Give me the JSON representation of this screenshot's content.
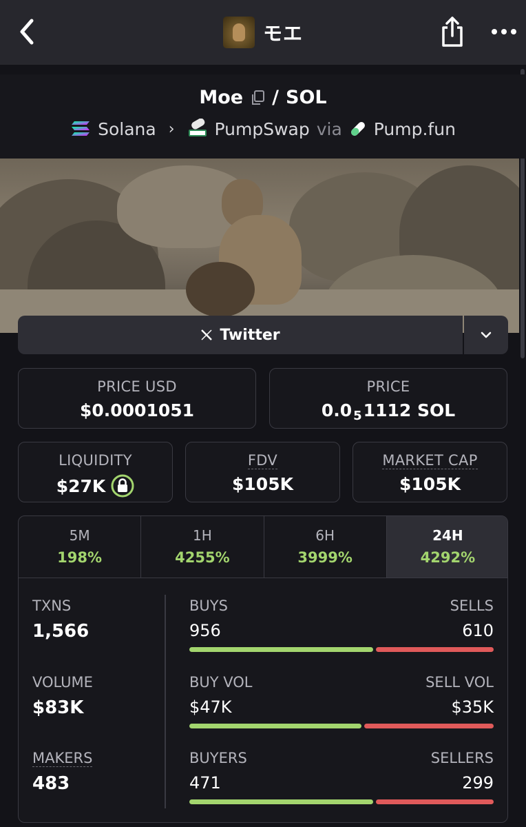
{
  "nav": {
    "title": "モエ",
    "icons": {
      "back": "chevron-left-icon",
      "share": "share-icon",
      "more": "more-dots-icon"
    }
  },
  "header": {
    "pair_base": "Moe",
    "pair_sep": "/",
    "pair_quote": "SOL",
    "chain": "Solana",
    "dex": "PumpSwap",
    "via_label": "via",
    "launchpad": "Pump.fun"
  },
  "social": {
    "twitter_label": "Twitter"
  },
  "stats": {
    "price_usd": {
      "label": "PRICE USD",
      "value": "$0.0001051"
    },
    "price": {
      "label": "PRICE",
      "prefix": "0.0",
      "sub": "5",
      "suffix": "1112 SOL"
    },
    "liquidity": {
      "label": "LIQUIDITY",
      "value": "$27K"
    },
    "fdv": {
      "label": "FDV",
      "value": "$105K"
    },
    "market_cap": {
      "label": "MARKET CAP",
      "value": "$105K"
    }
  },
  "timeframes": [
    {
      "label": "5M",
      "change": "198%"
    },
    {
      "label": "1H",
      "change": "4255%"
    },
    {
      "label": "6H",
      "change": "3999%"
    },
    {
      "label": "24H",
      "change": "4292%"
    }
  ],
  "active_timeframe": "24H",
  "metrics": {
    "txns": {
      "label": "TXNS",
      "value": "1,566"
    },
    "volume": {
      "label": "VOLUME",
      "value": "$83K"
    },
    "makers": {
      "label": "MAKERS",
      "value": "483"
    }
  },
  "splits": [
    {
      "left_label": "BUYS",
      "right_label": "SELLS",
      "left_value": "956",
      "right_value": "610",
      "buy_fraction": 0.61
    },
    {
      "left_label": "BUY VOL",
      "right_label": "SELL VOL",
      "left_value": "$47K",
      "right_value": "$35K",
      "buy_fraction": 0.57
    },
    {
      "left_label": "BUYERS",
      "right_label": "SELLERS",
      "left_value": "471",
      "right_value": "299",
      "buy_fraction": 0.61
    }
  ],
  "colors": {
    "positive": "#a3d56e",
    "negative": "#e05a5a",
    "background": "#131318"
  }
}
